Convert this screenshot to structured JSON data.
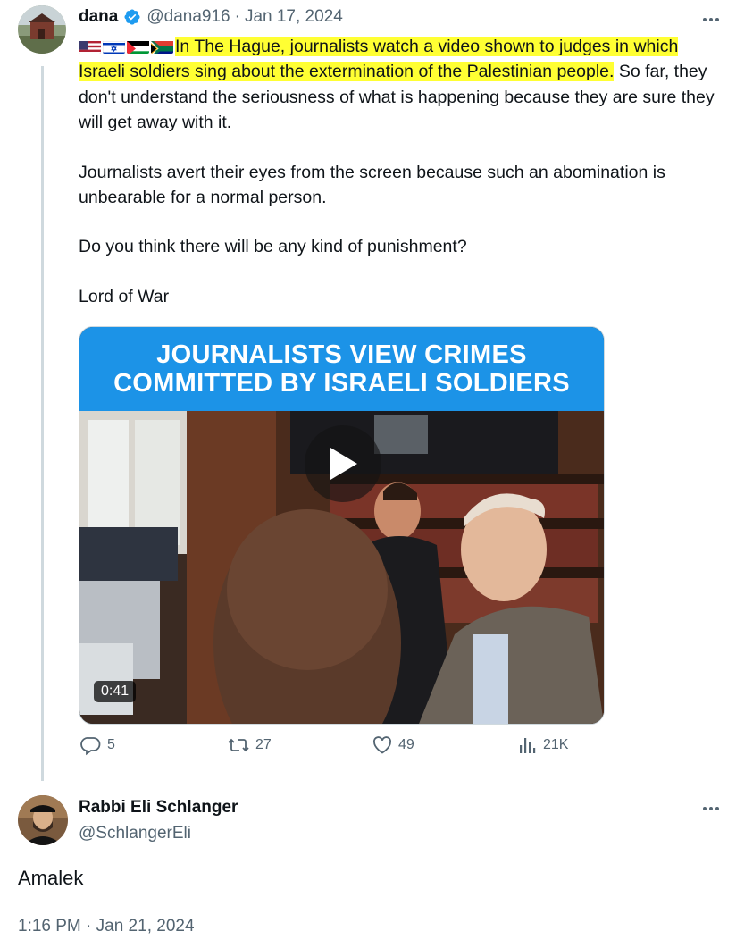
{
  "tweet": {
    "author": "dana",
    "handle": "@dana916",
    "separator": "·",
    "date": "Jan 17, 2024",
    "flags": [
      "us-flag",
      "israel-flag",
      "palestine-flag",
      "south-africa-flag"
    ],
    "text_highlight": "In The Hague, journalists watch a video shown to judges in which Israeli soldiers sing about the extermination of the Palestinian people.",
    "text_rest": " So far, they don't understand the seriousness of what is happening because they are sure they will get away with it.",
    "para2": "Journalists avert their eyes from the screen because such an abomination is unbearable for a normal person.",
    "para3": "Do you think there will be any kind of punishment?",
    "para4": "Lord of War",
    "media": {
      "banner_line1": "JOURNALISTS VIEW CRIMES",
      "banner_line2": "COMMITTED BY ISRAELI SOLDIERS",
      "duration": "0:41"
    },
    "stats": {
      "replies": "5",
      "retweets": "27",
      "likes": "49",
      "views": "21K"
    },
    "colors": {
      "highlight": "#ffff33",
      "banner": "#1c93e7",
      "verified": "#1d9bf0",
      "muted": "#536471"
    }
  },
  "reply": {
    "author": "Rabbi Eli Schlanger",
    "handle": "@SchlangerEli",
    "text": "Amalek",
    "timestamp": "1:16 PM · Jan 21, 2024"
  }
}
